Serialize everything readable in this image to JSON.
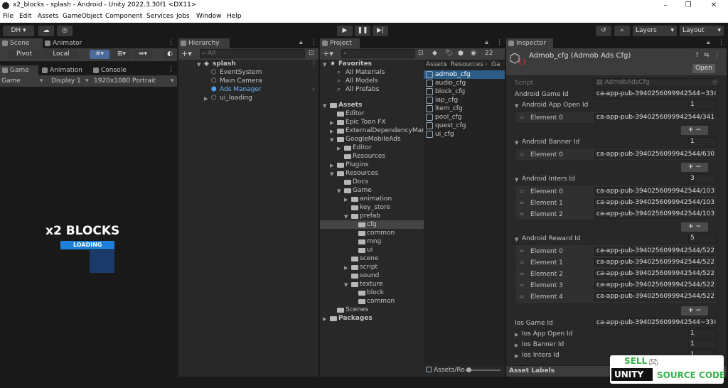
{
  "window": {
    "title": "x2_blocks - splash - Android - Unity 2022.3.30f1 <DX11>",
    "minimize": "–",
    "maximize": "❐",
    "close": "✕"
  },
  "menu": [
    "File",
    "Edit",
    "Assets",
    "GameObject",
    "Component",
    "Services",
    "Jobs",
    "Window",
    "Help"
  ],
  "toolbar": {
    "account": "DH ▾",
    "layers": "Layers",
    "layout": "Layout"
  },
  "scene_panel": {
    "tabs": [
      "Scene",
      "Animator"
    ],
    "pivot": "Pivot",
    "local": "Local",
    "game_tabs": [
      "Game",
      "Animation",
      "Console"
    ],
    "game_label": "Game",
    "display": "Display 1",
    "resolution": "1920x1080 Portrait",
    "game_title": "x2 BLOCKS",
    "loading": "LOADING"
  },
  "hierarchy": {
    "tab": "Hierarchy",
    "search_placeholder": "All",
    "scene": "splash",
    "items": [
      "EventSystem",
      "Main Camera",
      "Ads Manager",
      "ui_loading"
    ]
  },
  "project": {
    "tab": "Project",
    "count": "22",
    "favorites": "Favorites",
    "fav_items": [
      "All Materials",
      "All Models",
      "All Prefabs"
    ],
    "assets": "Assets",
    "tree": [
      "Editor",
      "Epic Toon FX",
      "ExternalDependencyManager",
      "GoogleMobileAds",
      "Editor",
      "Resources",
      "Plugins",
      "Resources",
      "Docs",
      "Game",
      "animation",
      "key_store",
      "prefab",
      "cfg",
      "common",
      "mng",
      "ui",
      "scene",
      "script",
      "sound",
      "texture",
      "block",
      "common",
      "Scenes"
    ],
    "packages": "Packages",
    "breadcrumb": [
      "Assets",
      "Resources",
      "Ga"
    ],
    "files": [
      "admob_cfg",
      "audio_cfg",
      "block_cfg",
      "iap_cfg",
      "item_cfg",
      "pool_cfg",
      "quest_cfg",
      "ui_cfg"
    ],
    "footer": "Assets/Re"
  },
  "inspector": {
    "tab": "Inspector",
    "title": "Admob_cfg (Admob Ads Cfg)",
    "open": "Open",
    "script_label": "Script",
    "script_value": "AdmobAdsCfg",
    "android_game_id_label": "Android Game Id",
    "android_game_id": "ca-app-pub-3940256099942544~334",
    "app_open_label": "Android App Open Id",
    "app_open_count": "1",
    "app_open": [
      {
        "label": "Element 0",
        "value": "ca-app-pub-3940256099942544/341"
      }
    ],
    "banner_label": "Android Banner Id",
    "banner_count": "1",
    "banner": [
      {
        "label": "Element 0",
        "value": "ca-app-pub-3940256099942544/630"
      }
    ],
    "inters_label": "Android Inters Id",
    "inters_count": "3",
    "inters": [
      {
        "label": "Element 0",
        "value": "ca-app-pub-3940256099942544/103"
      },
      {
        "label": "Element 1",
        "value": "ca-app-pub-3940256099942544/103"
      },
      {
        "label": "Element 2",
        "value": "ca-app-pub-3940256099942544/103"
      }
    ],
    "reward_label": "Android Reward Id",
    "reward_count": "5",
    "reward": [
      {
        "label": "Element 0",
        "value": "ca-app-pub-3940256099942544/522"
      },
      {
        "label": "Element 1",
        "value": "ca-app-pub-3940256099942544/522"
      },
      {
        "label": "Element 2",
        "value": "ca-app-pub-3940256099942544/522"
      },
      {
        "label": "Element 3",
        "value": "ca-app-pub-3940256099942544/522"
      },
      {
        "label": "Element 4",
        "value": "ca-app-pub-3940256099942544/522"
      }
    ],
    "ios_game_id_label": "Ios Game Id",
    "ios_game_id": "ca-app-pub-3940256099942544~334",
    "ios_app_open_label": "Ios App Open Id",
    "ios_app_open_count": "1",
    "ios_banner_label": "Ios Banner Id",
    "ios_banner_count": "1",
    "ios_inters_label": "Ios Inters Id",
    "ios_inters_count": "1",
    "plus": "+",
    "minus": "−",
    "asset_labels": "Asset Labels"
  },
  "watermark": {
    "top": "SELL",
    "bottom_left": "UNITY",
    "bottom_right": "SOURCE CODE"
  }
}
